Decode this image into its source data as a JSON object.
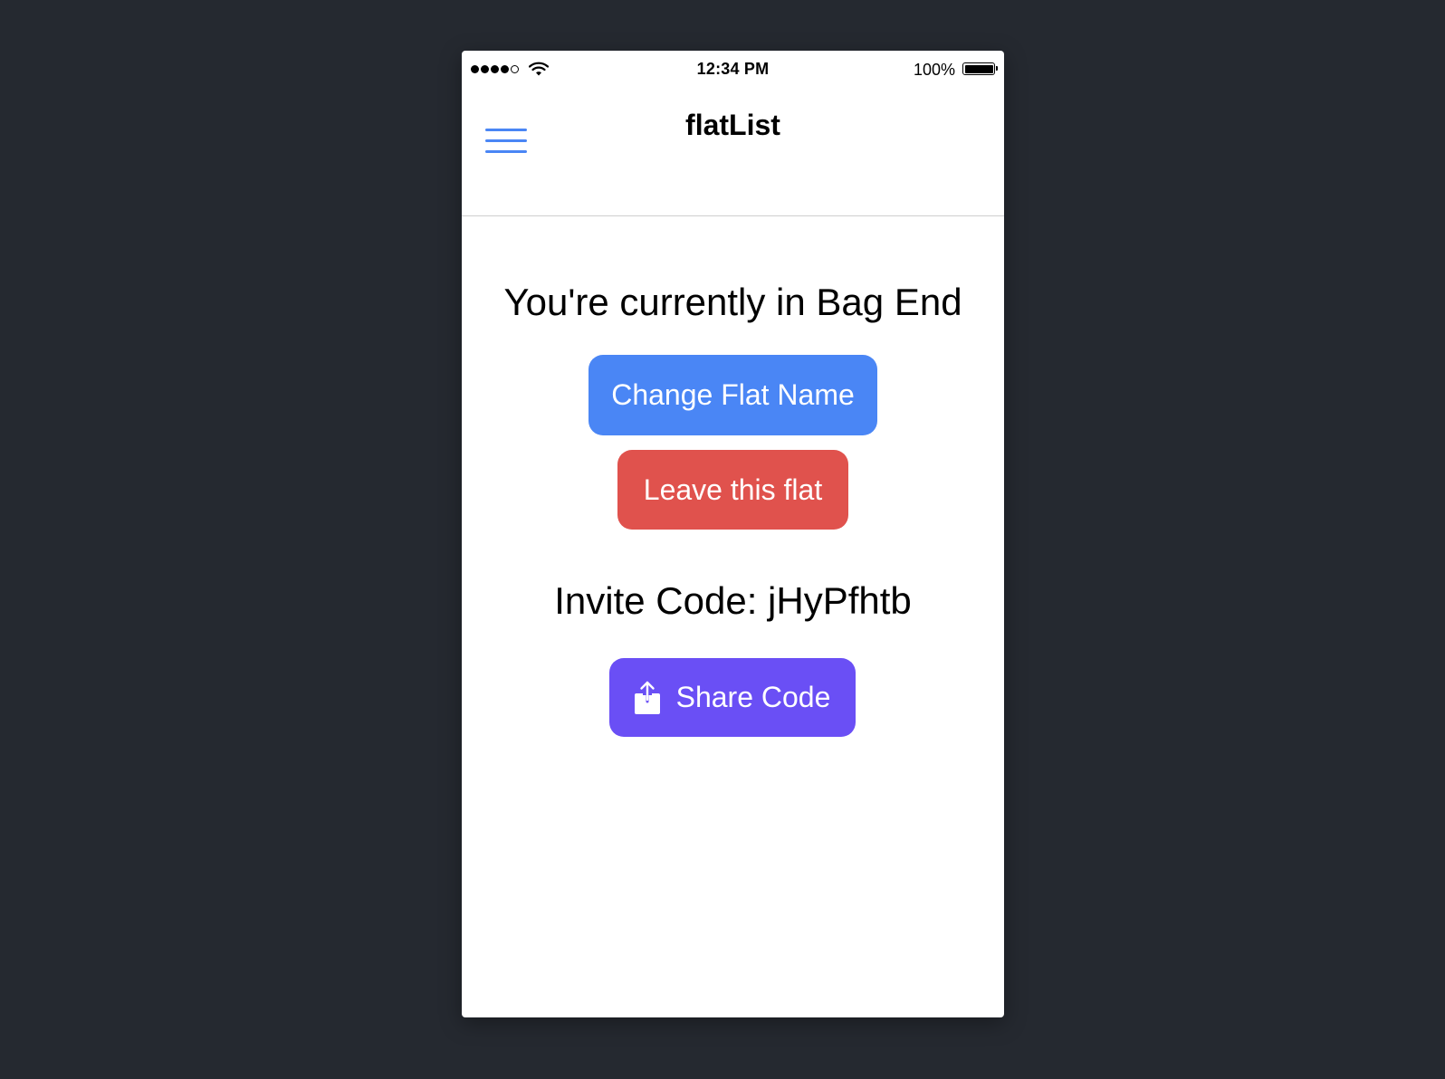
{
  "status_bar": {
    "time": "12:34 PM",
    "battery_percent": "100%",
    "signal_bars_filled": 4,
    "signal_bars_total": 5,
    "battery_level": 1.0
  },
  "nav": {
    "title": "flatList",
    "menu_icon": "hamburger-menu-icon"
  },
  "main": {
    "current_flat_text": "You're currently in Bag End",
    "change_flat_name_label": "Change Flat Name",
    "leave_flat_label": "Leave this flat",
    "invite_code_text": "Invite Code: jHyPfhtb",
    "share_code_label": "Share Code",
    "share_icon": "share-upload-icon"
  },
  "colors": {
    "background": "#252930",
    "accent_blue": "#4a86f5",
    "danger_red": "#e0524d",
    "share_purple": "#6a4ff5"
  }
}
